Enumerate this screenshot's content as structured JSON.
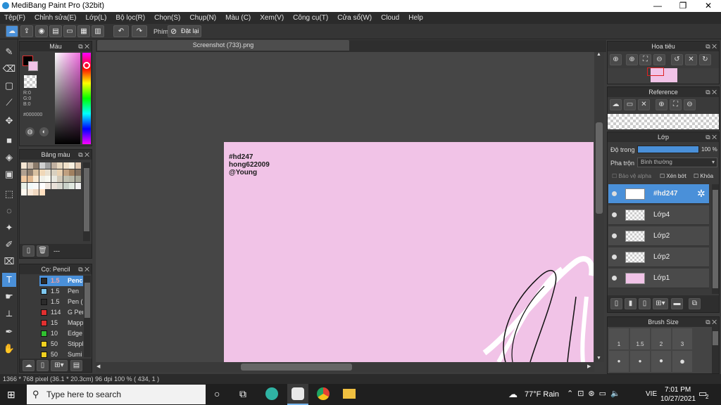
{
  "window": {
    "title": "MediBang Paint Pro (32bit)",
    "minimize": "—",
    "maximize": "❐",
    "close": "✕"
  },
  "menu": [
    "Tệp(F)",
    "Chỉnh sửa(E)",
    "Lớp(L)",
    "Bộ lọc(R)",
    "Chọn(S)",
    "Chụp(N)",
    "Màu (C)",
    "Xem(V)",
    "Công cụ(T)",
    "Cửa sổ(W)",
    "Cloud",
    "Help"
  ],
  "toolbar": {
    "phim_label": "Phím",
    "reset_label": "Đặt lại"
  },
  "color_panel": {
    "title": "Màu",
    "r": "R:0",
    "g": "G:0",
    "b": "B:0",
    "hex": "#000000",
    "primary": "#000000",
    "secondary": "#f1c3e7"
  },
  "palette_panel": {
    "title": "Bảng màu",
    "footer": "---"
  },
  "brush_panel": {
    "title": "Cọ: Pencil",
    "items": [
      {
        "size": "1.5",
        "name": "Pencil",
        "color": "#2b2b2b"
      },
      {
        "size": "1.5",
        "name": "Pen",
        "color": "#7ec8f0"
      },
      {
        "size": "1.5",
        "name": "Pen (Sharp",
        "color": "#2b2b2b"
      },
      {
        "size": "114",
        "name": "G Pen",
        "color": "#e03030"
      },
      {
        "size": "15",
        "name": "Mapping Pe",
        "color": "#e03030"
      },
      {
        "size": "10",
        "name": "Edge Pen",
        "color": "#30c030"
      },
      {
        "size": "50",
        "name": "Stipple Pen",
        "color": "#f0d020"
      },
      {
        "size": "50",
        "name": "Sumi",
        "color": "#f0d020"
      }
    ]
  },
  "canvas": {
    "tab": "Screenshot (733).png",
    "caption": [
      "#hd247",
      "hong622009",
      "@Young"
    ],
    "background": "#f1c3e7"
  },
  "navigator": {
    "title": "Hoa tiêu"
  },
  "reference": {
    "title": "Reference"
  },
  "layer_panel": {
    "title": "Lớp",
    "opacity_label": "Độ trong",
    "opacity_value": "100 %",
    "opacity": 1.0,
    "blend_label": "Pha trộn",
    "blend_value": "Bình thường",
    "protect_alpha": "Bảo vệ alpha",
    "clipping": "Xén bớt",
    "lock": "Khóa",
    "layers": [
      {
        "name": "#hd247",
        "selected": true
      },
      {
        "name": "Lớp4",
        "selected": false
      },
      {
        "name": "Lớp2",
        "selected": false
      },
      {
        "name": "Lớp2",
        "selected": false
      },
      {
        "name": "Lớp1",
        "selected": false
      }
    ]
  },
  "brush_size": {
    "title": "Brush Size",
    "labels": [
      "1",
      "1.5",
      "2",
      "3"
    ]
  },
  "status": "1366 * 768 pixel   (36.1 * 20.3cm)   96 dpi   100 %   ( 434, 1 )",
  "taskbar": {
    "search_placeholder": "Type here to search",
    "weather": "77°F  Rain",
    "lang": "VIE",
    "time": "7:01 PM",
    "date": "10/27/2021",
    "notifications": "2"
  }
}
